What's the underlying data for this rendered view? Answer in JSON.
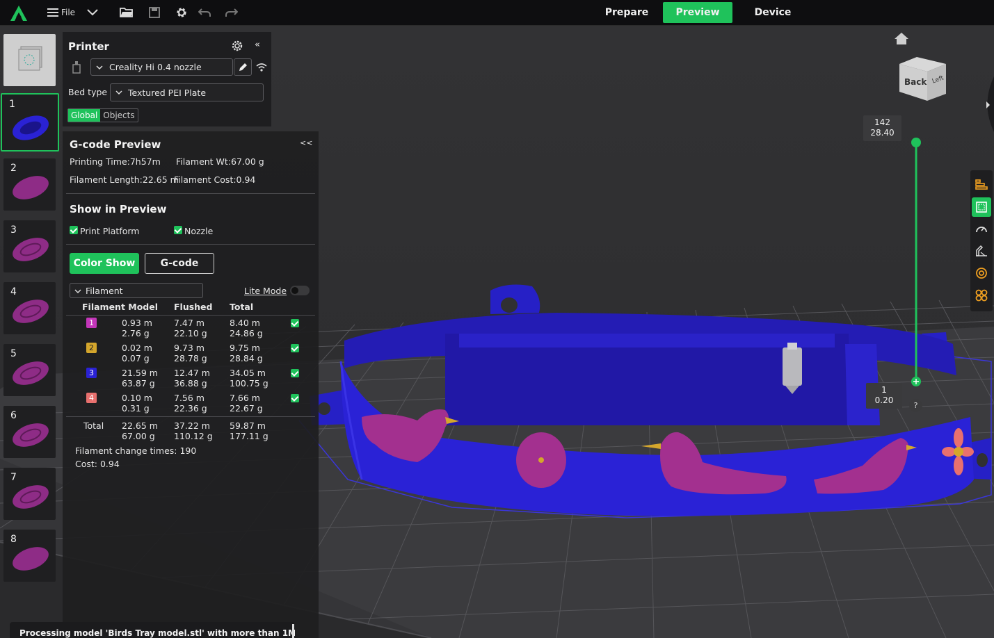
{
  "topbar": {
    "file_label": "File",
    "modes": [
      {
        "label": "Prepare",
        "active": false
      },
      {
        "label": "Preview",
        "active": true
      },
      {
        "label": "Device",
        "active": false
      }
    ],
    "icons": [
      "creality-logo-icon",
      "menu-icon",
      "chevron-down-icon",
      "open-folder-icon",
      "save-icon",
      "settings-gear-icon",
      "undo-icon",
      "redo-icon"
    ]
  },
  "plates": [
    "1",
    "2",
    "3",
    "4",
    "5",
    "6",
    "7",
    "8"
  ],
  "printer": {
    "title": "Printer",
    "printer_name": "Creality Hi 0.4 nozzle",
    "bed_type_label": "Bed type",
    "bed_type_value": "Textured PEI Plate",
    "tabs": [
      {
        "label": "Global",
        "active": true
      },
      {
        "label": "Objects",
        "active": false
      }
    ]
  },
  "gcode": {
    "title": "G-code Preview",
    "collapse_label": "<<",
    "printing_time": "Printing Time:7h57m",
    "filament_wt": "Filament Wt:67.00 g",
    "filament_length": "Filament Length:22.65 m",
    "filament_cost": "Filament Cost:0.94",
    "show_title": "Show in Preview",
    "show_print_platform": "Print Platform",
    "show_nozzle": "Nozzle",
    "btn_color_show": "Color Show",
    "btn_gcode": "G-code",
    "view_select": "Filament",
    "lite_mode": "Lite Mode",
    "headers": {
      "model": "Filament Model",
      "flushed": "Flushed",
      "total": "Total"
    },
    "rows": [
      {
        "id": "1",
        "color": "#c336b9",
        "model_m": "0.93 m",
        "model_g": "2.76 g",
        "flushed_m": "7.47 m",
        "flushed_g": "22.10 g",
        "total_m": "8.40 m",
        "total_g": "24.86 g"
      },
      {
        "id": "2",
        "color": "#d4a62c",
        "model_m": "0.02 m",
        "model_g": "0.07 g",
        "flushed_m": "9.73 m",
        "flushed_g": "28.78 g",
        "total_m": "9.75 m",
        "total_g": "28.84 g"
      },
      {
        "id": "3",
        "color": "#2a22d4",
        "model_m": "21.59 m",
        "model_g": "63.87 g",
        "flushed_m": "12.47 m",
        "flushed_g": "36.88 g",
        "total_m": "34.05 m",
        "total_g": "100.75 g"
      },
      {
        "id": "4",
        "color": "#e8706e",
        "model_m": "0.10 m",
        "model_g": "0.31 g",
        "flushed_m": "7.56 m",
        "flushed_g": "22.36 g",
        "total_m": "7.66 m",
        "total_g": "22.67 g"
      }
    ],
    "total_label": "Total",
    "total": {
      "model_m": "22.65 m",
      "model_g": "67.00 g",
      "flushed_m": "37.22 m",
      "flushed_g": "110.12 g",
      "total_m": "59.87 m",
      "total_g": "177.11 g"
    },
    "change_times": "Filament change times:  190",
    "cost": "Cost:  0.94"
  },
  "layer_slider": {
    "top_layer": "142",
    "top_height": "28.40",
    "bottom_layer": "1",
    "bottom_height": "0.20",
    "help": "?"
  },
  "view_cube": {
    "back": "Back",
    "left": "Left"
  },
  "status_message": "Processing model 'Birds Tray model.stl' with more than 1M",
  "colors": {
    "accent": "#1fc25b",
    "model_blue": "#2a22d4",
    "model_purple": "#a3308f"
  }
}
